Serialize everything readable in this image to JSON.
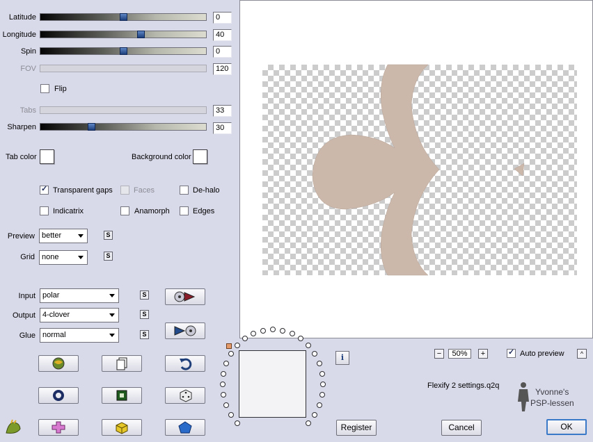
{
  "sliders": {
    "latitude": {
      "label": "Latitude",
      "value": "0"
    },
    "longitude": {
      "label": "Longitude",
      "value": "40"
    },
    "spin": {
      "label": "Spin",
      "value": "0"
    },
    "fov": {
      "label": "FOV",
      "value": "120"
    },
    "tabs": {
      "label": "Tabs",
      "value": "33"
    },
    "sharpen": {
      "label": "Sharpen",
      "value": "30"
    }
  },
  "flip_label": "Flip",
  "tab_color_label": "Tab color",
  "background_color_label": "Background color",
  "options": {
    "transparent_gaps": {
      "label": "Transparent gaps",
      "checked": true
    },
    "faces": {
      "label": "Faces",
      "checked": false
    },
    "de_halo": {
      "label": "De-halo",
      "checked": false
    },
    "indicatrix": {
      "label": "Indicatrix",
      "checked": false
    },
    "anamorph": {
      "label": "Anamorph",
      "checked": false
    },
    "edges": {
      "label": "Edges",
      "checked": false
    }
  },
  "preview_quality": {
    "label": "Preview",
    "value": "better"
  },
  "grid": {
    "label": "Grid",
    "value": "none"
  },
  "input": {
    "label": "Input",
    "value": "polar"
  },
  "output": {
    "label": "Output",
    "value": "4-clover"
  },
  "glue": {
    "label": "Glue",
    "value": "normal"
  },
  "s_button": "S",
  "zoom": {
    "minus": "−",
    "value": "50%",
    "plus": "+"
  },
  "auto_preview": {
    "label": "Auto preview",
    "checked": true
  },
  "collapse_button": "^",
  "info_button": "i",
  "settings_file": "Flexify 2 settings.q2q",
  "watermark": {
    "line1": "Yvonne's",
    "line2": "PSP-lessen"
  },
  "buttons": {
    "register": "Register",
    "cancel": "Cancel",
    "ok": "OK"
  },
  "colors": {
    "shape": "#cbb8ab",
    "background": "#d8d9e9",
    "accent": "#3a78c8"
  }
}
